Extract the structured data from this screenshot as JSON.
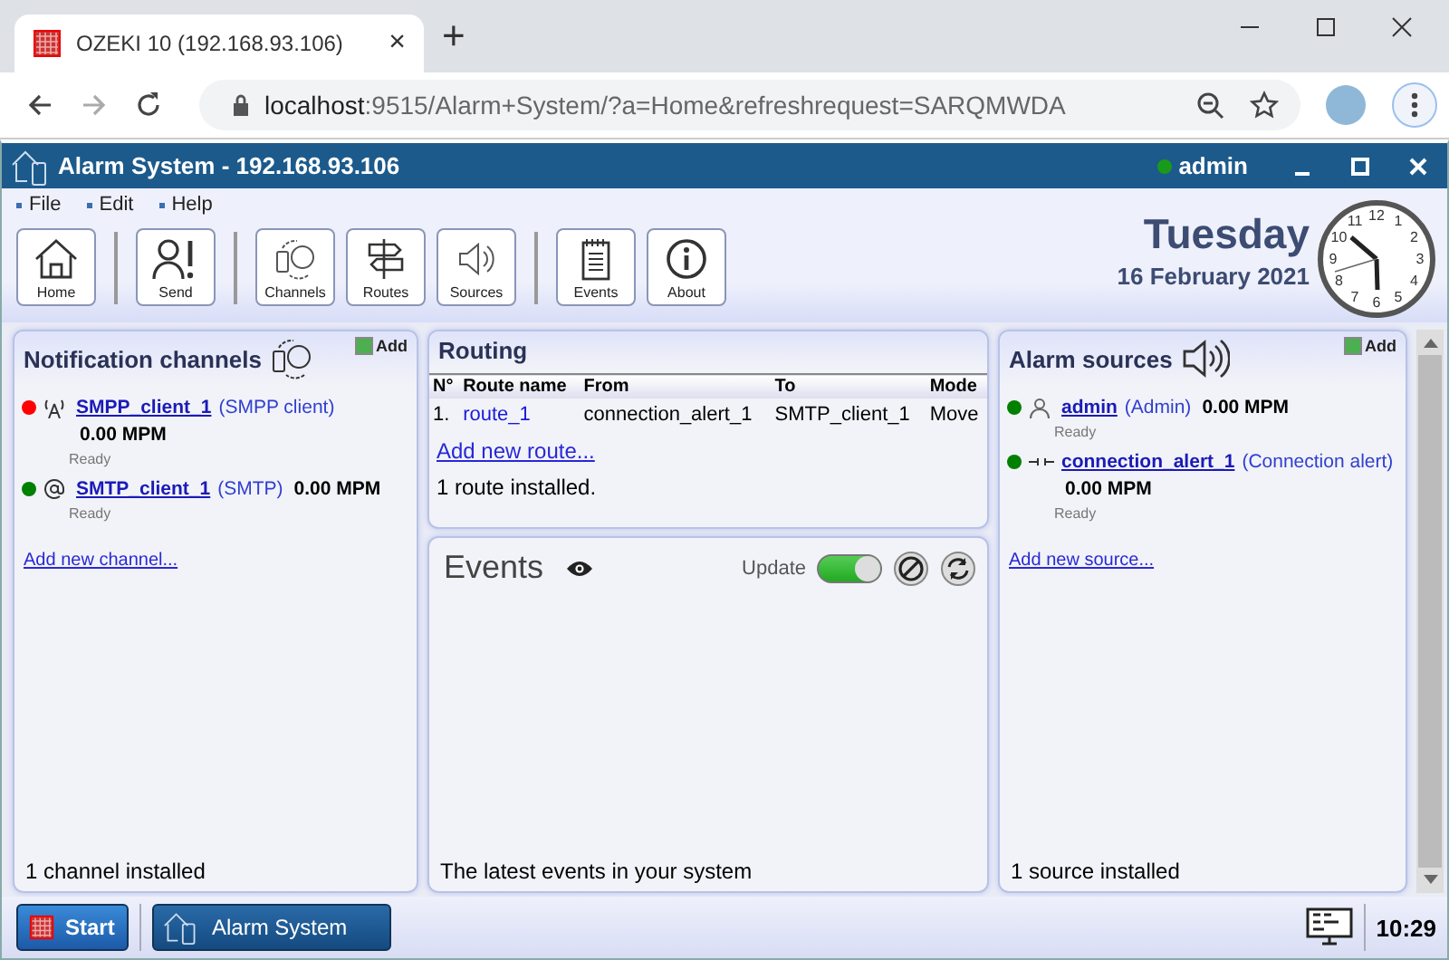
{
  "browser": {
    "tab_title": "OZEKI 10 (192.168.93.106)",
    "tab_close": "×",
    "new_tab": "+",
    "url_host": "localhost",
    "url_rest": ":9515/Alarm+System/?a=Home&refreshrequest=SARQMWDA"
  },
  "window": {
    "title": "Alarm System - 192.168.93.106",
    "user": "admin",
    "user_online": true
  },
  "menu": [
    "File",
    "Edit",
    "Help"
  ],
  "toolbar": [
    [
      {
        "label": "Home"
      }
    ],
    [
      {
        "label": "Send"
      }
    ],
    [
      {
        "label": "Channels"
      },
      {
        "label": "Routes"
      },
      {
        "label": "Sources"
      }
    ],
    [
      {
        "label": "Events"
      },
      {
        "label": "About"
      }
    ]
  ],
  "date": {
    "day": "Tuesday",
    "date": "16 February 2021"
  },
  "clock": {
    "numerals": [
      "11",
      "12",
      "1",
      "10",
      "2",
      "9",
      "3",
      "8",
      "4",
      "7",
      "6",
      "5"
    ]
  },
  "channels_panel": {
    "title": "Notification channels",
    "add": "Add",
    "items": [
      {
        "name": "SMPP_client_1",
        "type": "(SMPP client)",
        "rate": "0.00 MPM",
        "status": "Ready",
        "color": "#ff0000"
      },
      {
        "name": "SMTP_client_1",
        "type": "(SMTP)",
        "rate": "0.00 MPM",
        "status": "Ready",
        "color": "#008000"
      }
    ],
    "add_link": "Add new channel...",
    "footer": "1 channel installed"
  },
  "routing": {
    "title": "Routing",
    "columns": [
      "N°",
      "Route name",
      "From",
      "To",
      "Mode"
    ],
    "rows": [
      [
        "1.",
        "route_1",
        "connection_alert_1",
        "SMTP_client_1",
        "Move"
      ]
    ],
    "add_link": "Add new route...",
    "footer": "1 route installed."
  },
  "events": {
    "title": "Events",
    "update": {
      "label": "Update",
      "on": true
    },
    "footer": "The latest events in your system"
  },
  "sources_panel": {
    "title": "Alarm sources",
    "add": "Add",
    "items": [
      {
        "name": "admin",
        "type": "(Admin)",
        "rate": "0.00 MPM",
        "status": "Ready",
        "color": "#008000"
      },
      {
        "name": "connection_alert_1",
        "type": "(Connection alert)",
        "rate": "0.00 MPM",
        "status": "Ready",
        "color": "#008000"
      }
    ],
    "add_link": "Add new source...",
    "footer": "1 source installed"
  },
  "taskbar": {
    "start": "Start",
    "apps": [
      {
        "label": "Alarm System",
        "selected": true
      }
    ],
    "time": "10:29"
  }
}
